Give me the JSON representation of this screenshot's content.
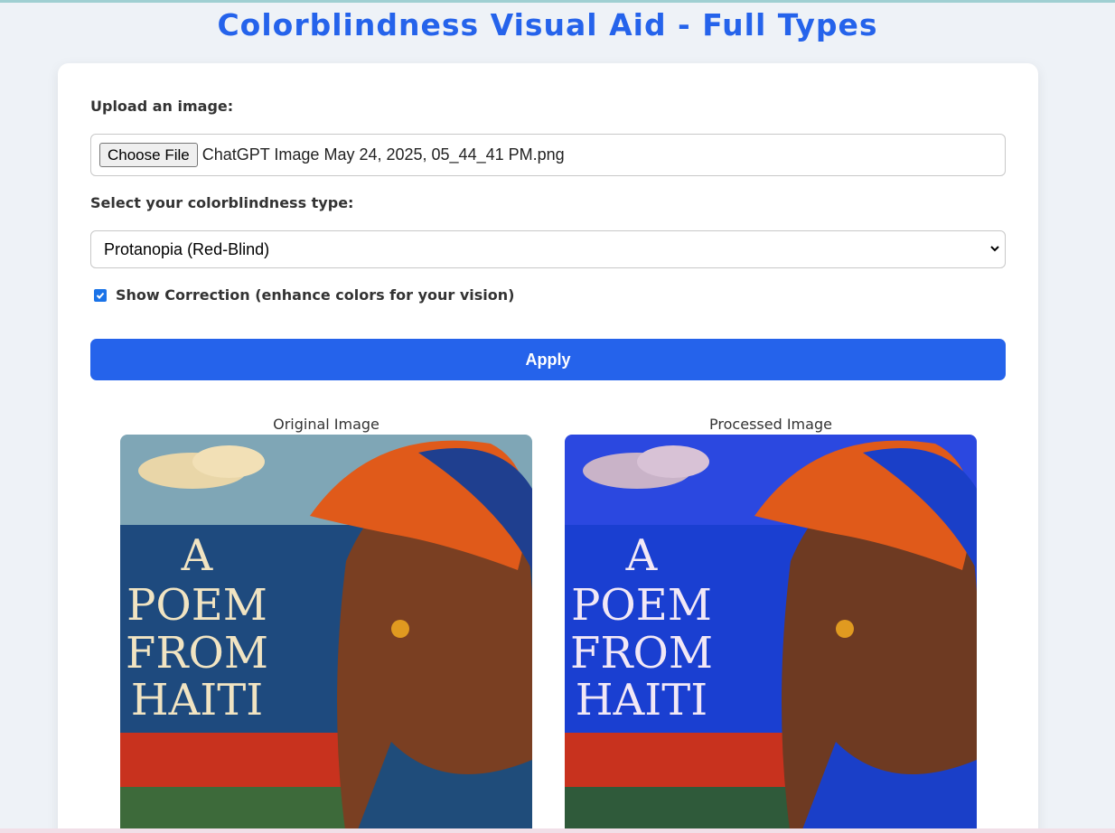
{
  "page": {
    "title": "Colorblindness Visual Aid - Full Types"
  },
  "upload": {
    "label": "Upload an image:",
    "button_label": "Choose File",
    "file_name": "ChatGPT Image May 24, 2025, 05_44_41 PM.png"
  },
  "type_select": {
    "label": "Select your colorblindness type:",
    "selected": "Protanopia (Red-Blind)"
  },
  "correction": {
    "checked": true,
    "label": "Show Correction (enhance colors for your vision)"
  },
  "apply_button": {
    "label": "Apply"
  },
  "images": {
    "original_caption": "Original Image",
    "processed_caption": "Processed Image",
    "cover_lines": [
      "A",
      "POEM",
      "FROM",
      "HAITI"
    ]
  },
  "colors": {
    "accent": "#2563eb",
    "original_sky": "#7fa6b6",
    "original_sea": "#1e4a7e",
    "processed_sky": "#2b48e0",
    "processed_sea": "#1a3fd1"
  }
}
